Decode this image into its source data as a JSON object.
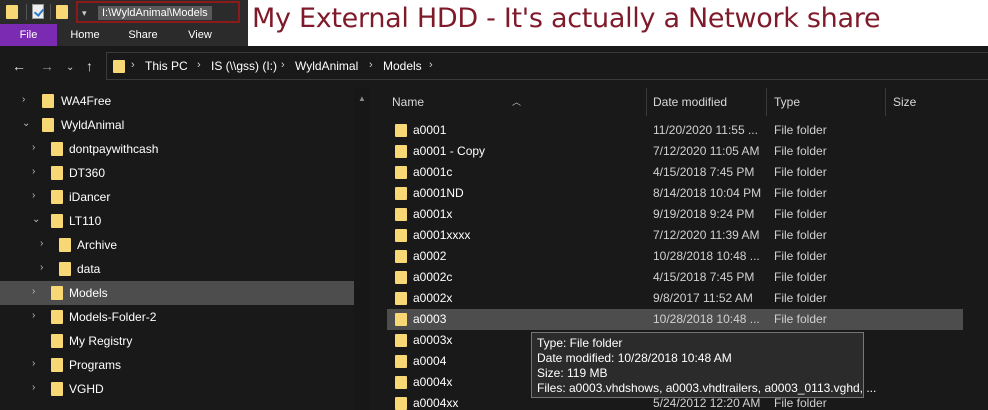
{
  "title_bar": {
    "path": "I:\\WyldAnimal\\Models",
    "dropdown_glyph": "▾"
  },
  "ribbon": {
    "tabs": [
      "File",
      "Home",
      "Share",
      "View"
    ],
    "file_color": "#7a2bb2"
  },
  "annotation": {
    "text": "My External HDD - It's actually a Network share",
    "color": "#7f1a2a"
  },
  "address_bar": {
    "crumbs": [
      "This PC",
      "IS (\\\\gss) (I:)",
      "WyldAnimal",
      "Models"
    ],
    "back_icon": "arrow-left-icon",
    "forward_icon": "arrow-right-icon",
    "recent_icon": "chevron-down-icon",
    "up_icon": "arrow-up-icon"
  },
  "nav_pane": {
    "items": [
      {
        "label": "WA4Free",
        "expander": "›"
      },
      {
        "label": "WyldAnimal",
        "expander": "⌄"
      },
      {
        "label": "dontpaywithcash",
        "expander": "›"
      },
      {
        "label": "DT360",
        "expander": "›"
      },
      {
        "label": "iDancer",
        "expander": "›"
      },
      {
        "label": "LT110",
        "expander": "⌄"
      },
      {
        "label": "Archive",
        "expander": "›"
      },
      {
        "label": "data",
        "expander": "›"
      },
      {
        "label": "Models",
        "expander": "›",
        "selected": true
      },
      {
        "label": "Models-Folder-2",
        "expander": "›"
      },
      {
        "label": "My Registry",
        "expander": ""
      },
      {
        "label": "Programs",
        "expander": "›"
      },
      {
        "label": "VGHD",
        "expander": "›"
      }
    ]
  },
  "file_list": {
    "columns": [
      "Name",
      "Date modified",
      "Type",
      "Size"
    ],
    "rows": [
      {
        "name": "a0001",
        "date": "11/20/2020 11:55 ...",
        "type": "File folder"
      },
      {
        "name": "a0001 - Copy",
        "date": "7/12/2020 11:05 AM",
        "type": "File folder"
      },
      {
        "name": "a0001c",
        "date": "4/15/2018 7:45 PM",
        "type": "File folder"
      },
      {
        "name": "a0001ND",
        "date": "8/14/2018 10:04 PM",
        "type": "File folder"
      },
      {
        "name": "a0001x",
        "date": "9/19/2018 9:24 PM",
        "type": "File folder"
      },
      {
        "name": "a0001xxxx",
        "date": "7/12/2020 11:39 AM",
        "type": "File folder"
      },
      {
        "name": "a0002",
        "date": "10/28/2018 10:48 ...",
        "type": "File folder"
      },
      {
        "name": "a0002c",
        "date": "4/15/2018 7:45 PM",
        "type": "File folder"
      },
      {
        "name": "a0002x",
        "date": "9/8/2017 11:52 AM",
        "type": "File folder"
      },
      {
        "name": "a0003",
        "date": "10/28/2018 10:48 ...",
        "type": "File folder",
        "selected": true
      },
      {
        "name": "a0003x",
        "date": "",
        "type": ""
      },
      {
        "name": "a0004",
        "date": "",
        "type": ""
      },
      {
        "name": "a0004x",
        "date": "",
        "type": ""
      },
      {
        "name": "a0004xx",
        "date": "5/24/2012 12:20 AM",
        "type": "File folder"
      }
    ]
  },
  "tooltip": {
    "lines": [
      "Type: File folder",
      "Date modified: 10/28/2018 10:48 AM",
      "Size: 119 MB",
      "Files: a0003.vhdshows, a0003.vhdtrailers, a0003_0113.vghd, ..."
    ]
  }
}
